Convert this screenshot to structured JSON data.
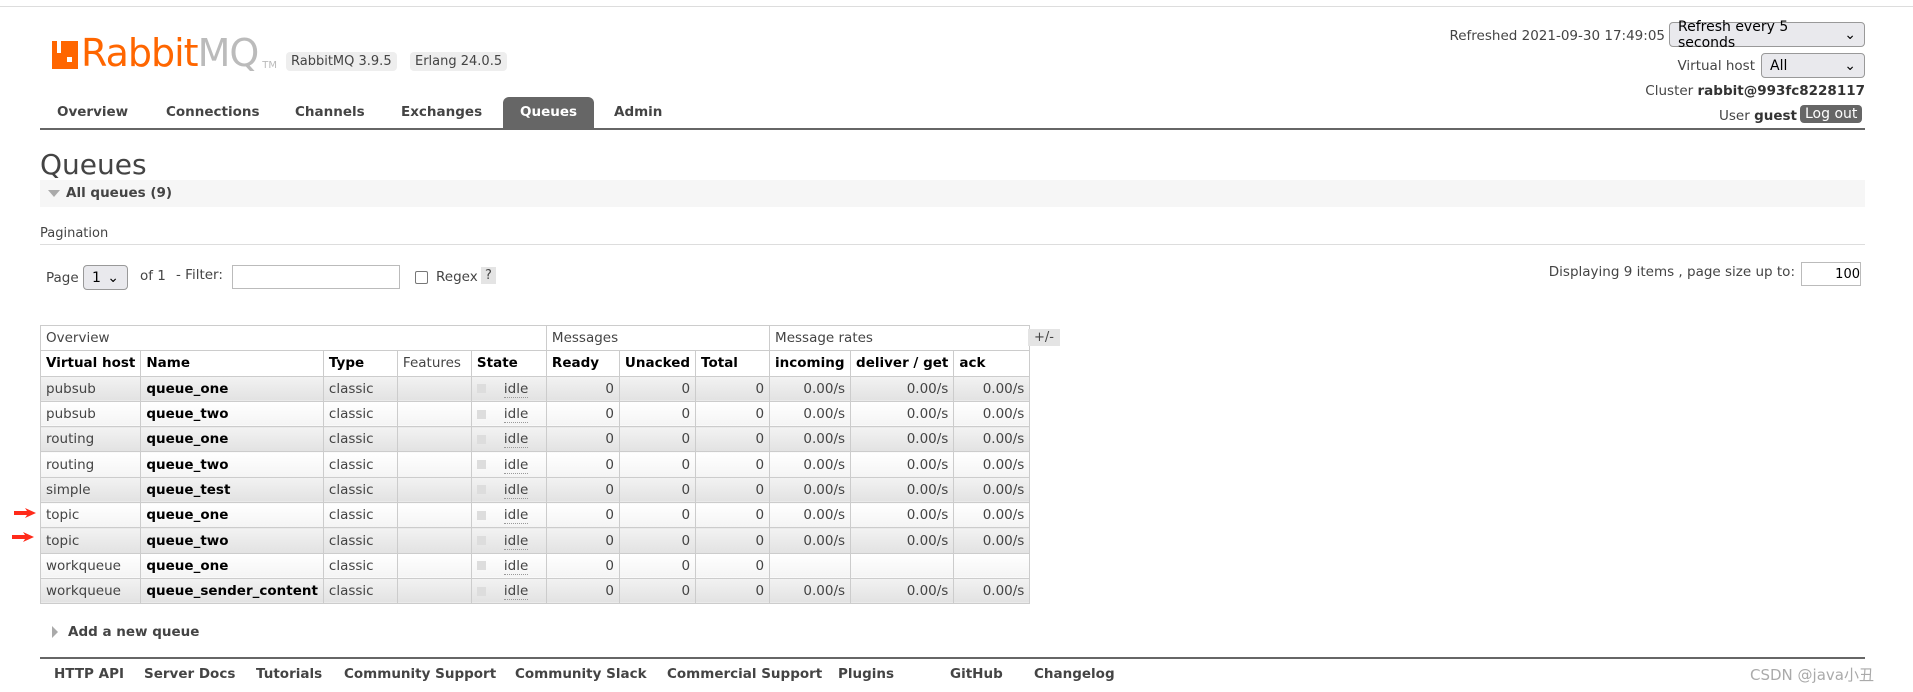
{
  "header": {
    "logo_brand": "Rabbit",
    "logo_mq": "MQ",
    "logo_tm": "TM",
    "version_badge": "RabbitMQ 3.9.5",
    "erlang_badge": "Erlang 24.0.5",
    "refreshed": "Refreshed 2021-09-30 17:49:05",
    "refresh_select": "Refresh every 5 seconds",
    "vhost_label": "Virtual host",
    "vhost_select": "All",
    "cluster_label": "Cluster",
    "cluster_name": "rabbit@993fc8228117",
    "user_label": "User",
    "user_name": "guest",
    "logout": "Log out"
  },
  "tabs": [
    "Overview",
    "Connections",
    "Channels",
    "Exchanges",
    "Queues",
    "Admin"
  ],
  "active_tab": "Queues",
  "page": {
    "title": "Queues",
    "section": "All queues (9)",
    "pagination_label": "Pagination",
    "page_label": "Page",
    "page_value": "1",
    "of_label": "of 1",
    "filter_label": "- Filter:",
    "filter_value": "",
    "regex_label": "Regex",
    "help": "?",
    "displaying": "Displaying 9 items , page size up to:",
    "page_size": "100",
    "plus_minus": "+/-",
    "add_queue": "Add a new queue"
  },
  "table": {
    "groups": [
      "Overview",
      "Messages",
      "Message rates"
    ],
    "columns": [
      "Virtual host",
      "Name",
      "Type",
      "Features",
      "State",
      "Ready",
      "Unacked",
      "Total",
      "incoming",
      "deliver / get",
      "ack"
    ],
    "rows": [
      [
        "pubsub",
        "queue_one",
        "classic",
        "",
        "idle",
        "0",
        "0",
        "0",
        "0.00/s",
        "0.00/s",
        "0.00/s"
      ],
      [
        "pubsub",
        "queue_two",
        "classic",
        "",
        "idle",
        "0",
        "0",
        "0",
        "0.00/s",
        "0.00/s",
        "0.00/s"
      ],
      [
        "routing",
        "queue_one",
        "classic",
        "",
        "idle",
        "0",
        "0",
        "0",
        "0.00/s",
        "0.00/s",
        "0.00/s"
      ],
      [
        "routing",
        "queue_two",
        "classic",
        "",
        "idle",
        "0",
        "0",
        "0",
        "0.00/s",
        "0.00/s",
        "0.00/s"
      ],
      [
        "simple",
        "queue_test",
        "classic",
        "",
        "idle",
        "0",
        "0",
        "0",
        "0.00/s",
        "0.00/s",
        "0.00/s"
      ],
      [
        "topic",
        "queue_one",
        "classic",
        "",
        "idle",
        "0",
        "0",
        "0",
        "0.00/s",
        "0.00/s",
        "0.00/s"
      ],
      [
        "topic",
        "queue_two",
        "classic",
        "",
        "idle",
        "0",
        "0",
        "0",
        "0.00/s",
        "0.00/s",
        "0.00/s"
      ],
      [
        "workqueue",
        "queue_one",
        "classic",
        "",
        "idle",
        "0",
        "0",
        "0",
        "",
        "",
        ""
      ],
      [
        "workqueue",
        "queue_sender_content",
        "classic",
        "",
        "idle",
        "0",
        "0",
        "0",
        "0.00/s",
        "0.00/s",
        "0.00/s"
      ]
    ]
  },
  "annotations": {
    "arrow_color": "#ff2a1a",
    "arrow_rows": [
      "topic queue_one",
      "topic queue_two"
    ]
  },
  "footer": [
    "HTTP API",
    "Server Docs",
    "Tutorials",
    "Community Support",
    "Community Slack",
    "Commercial Support",
    "Plugins",
    "GitHub",
    "Changelog"
  ],
  "watermark": "CSDN @java小丑",
  "colors": {
    "brand": "#ff6600",
    "tab_active": "#666666"
  }
}
